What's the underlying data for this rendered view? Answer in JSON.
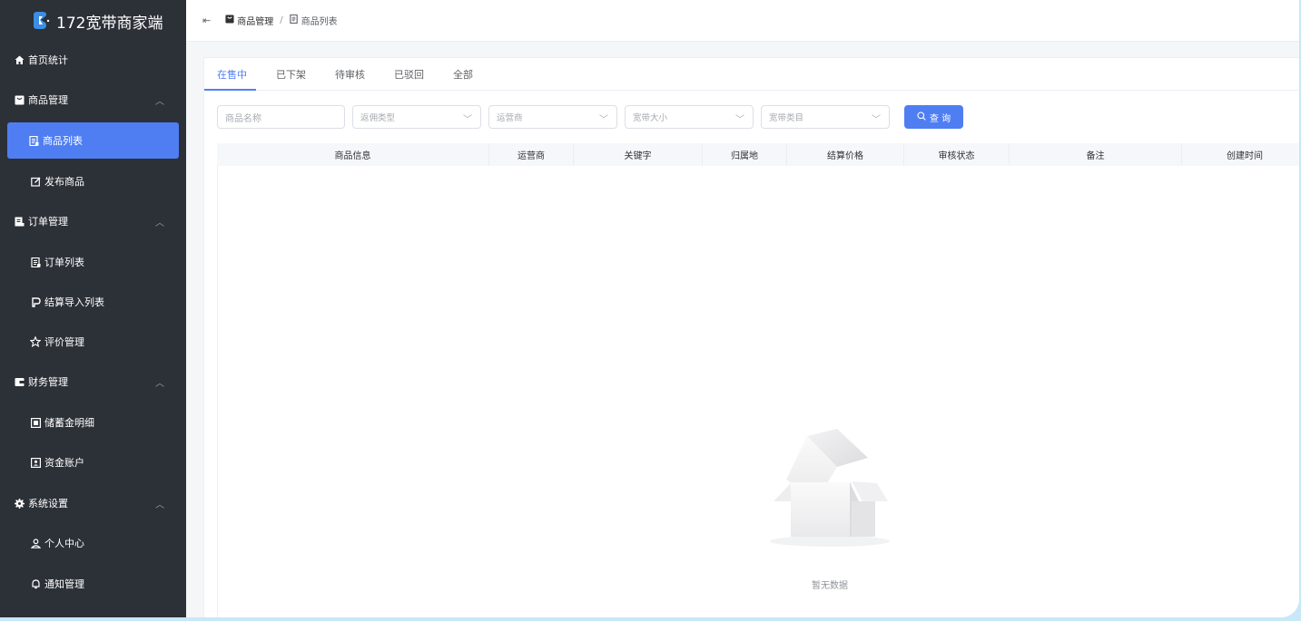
{
  "app": {
    "title": "172宽带商家端"
  },
  "sidebar": {
    "items": [
      {
        "label": "首页统计",
        "icon": "home-icon"
      },
      {
        "label": "商品管理",
        "icon": "goods-icon",
        "expanded": true
      },
      {
        "label": "商品列表",
        "icon": "list-icon",
        "active": true
      },
      {
        "label": "发布商品",
        "icon": "edit-icon"
      },
      {
        "label": "订单管理",
        "icon": "order-icon",
        "expanded": true
      },
      {
        "label": "订单列表",
        "icon": "list-icon"
      },
      {
        "label": "结算导入列表",
        "icon": "import-icon"
      },
      {
        "label": "评价管理",
        "icon": "star-icon"
      },
      {
        "label": "财务管理",
        "icon": "wallet-icon",
        "expanded": true
      },
      {
        "label": "储蓄金明细",
        "icon": "deposit-icon"
      },
      {
        "label": "资金账户",
        "icon": "account-icon"
      },
      {
        "label": "系统设置",
        "icon": "gear-icon",
        "expanded": true
      },
      {
        "label": "个人中心",
        "icon": "user-icon"
      },
      {
        "label": "通知管理",
        "icon": "bell-icon"
      }
    ]
  },
  "breadcrumb": {
    "parent": "商品管理",
    "separator": "/",
    "current": "商品列表"
  },
  "tabs": [
    "在售中",
    "已下架",
    "待审核",
    "已驳回",
    "全部"
  ],
  "filters": {
    "name_placeholder": "商品名称",
    "commission_type": "返佣类型",
    "operator": "运营商",
    "bandwidth_size": "宽带大小",
    "bandwidth_category": "宽带类目",
    "search_label": "查 询"
  },
  "table": {
    "columns": [
      "商品信息",
      "运营商",
      "关键字",
      "归属地",
      "结算价格",
      "审核状态",
      "备注",
      "创建时间"
    ],
    "empty_text": "暂无数据"
  },
  "colors": {
    "accent": "#4f7ef3",
    "sidebar_bg": "#2c3037",
    "frame_bg": "#c8e8f7"
  }
}
